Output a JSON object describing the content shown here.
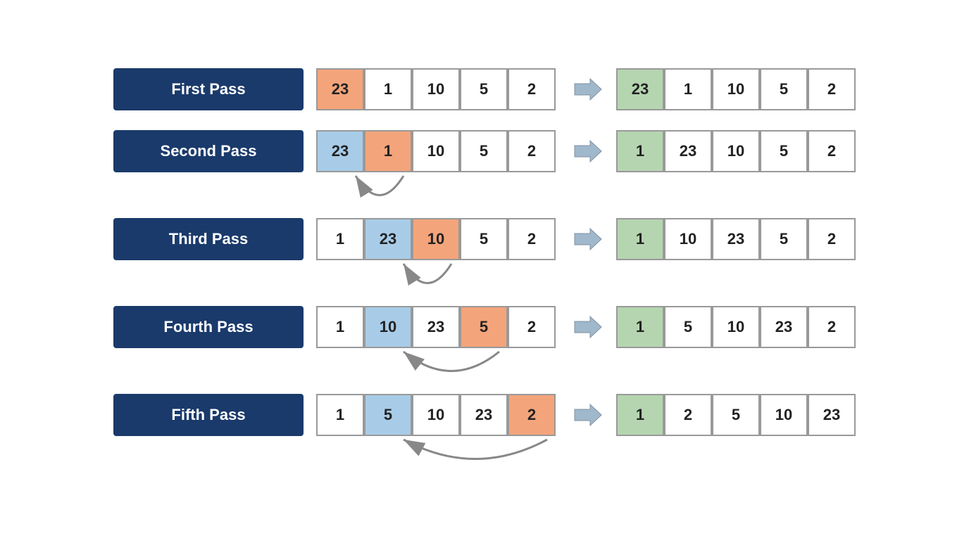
{
  "passes": [
    {
      "label": "First Pass",
      "before": [
        {
          "value": "23",
          "style": "orange"
        },
        {
          "value": "1",
          "style": ""
        },
        {
          "value": "10",
          "style": ""
        },
        {
          "value": "5",
          "style": ""
        },
        {
          "value": "2",
          "style": ""
        }
      ],
      "after": [
        {
          "value": "23",
          "style": "green"
        },
        {
          "value": "1",
          "style": ""
        },
        {
          "value": "10",
          "style": ""
        },
        {
          "value": "5",
          "style": ""
        },
        {
          "value": "2",
          "style": ""
        }
      ],
      "hasCurvedArrow": false,
      "curvedArrowFrom": 0,
      "curvedArrowTo": 0
    },
    {
      "label": "Second Pass",
      "before": [
        {
          "value": "23",
          "style": "blue"
        },
        {
          "value": "1",
          "style": "orange"
        },
        {
          "value": "10",
          "style": ""
        },
        {
          "value": "5",
          "style": ""
        },
        {
          "value": "2",
          "style": ""
        }
      ],
      "after": [
        {
          "value": "1",
          "style": "green"
        },
        {
          "value": "23",
          "style": ""
        },
        {
          "value": "10",
          "style": ""
        },
        {
          "value": "5",
          "style": ""
        },
        {
          "value": "2",
          "style": ""
        }
      ],
      "hasCurvedArrow": true,
      "curvedArrowFrom": 1,
      "curvedArrowTo": 0
    },
    {
      "label": "Third Pass",
      "before": [
        {
          "value": "1",
          "style": ""
        },
        {
          "value": "23",
          "style": "blue"
        },
        {
          "value": "10",
          "style": "orange"
        },
        {
          "value": "5",
          "style": ""
        },
        {
          "value": "2",
          "style": ""
        }
      ],
      "after": [
        {
          "value": "1",
          "style": "green"
        },
        {
          "value": "10",
          "style": ""
        },
        {
          "value": "23",
          "style": ""
        },
        {
          "value": "5",
          "style": ""
        },
        {
          "value": "2",
          "style": ""
        }
      ],
      "hasCurvedArrow": true,
      "curvedArrowFrom": 2,
      "curvedArrowTo": 1
    },
    {
      "label": "Fourth Pass",
      "before": [
        {
          "value": "1",
          "style": ""
        },
        {
          "value": "10",
          "style": "blue"
        },
        {
          "value": "23",
          "style": ""
        },
        {
          "value": "5",
          "style": "orange"
        },
        {
          "value": "2",
          "style": ""
        }
      ],
      "after": [
        {
          "value": "1",
          "style": "green"
        },
        {
          "value": "5",
          "style": ""
        },
        {
          "value": "10",
          "style": ""
        },
        {
          "value": "23",
          "style": ""
        },
        {
          "value": "2",
          "style": ""
        }
      ],
      "hasCurvedArrow": true,
      "curvedArrowFrom": 3,
      "curvedArrowTo": 1
    },
    {
      "label": "Fifth Pass",
      "before": [
        {
          "value": "1",
          "style": ""
        },
        {
          "value": "5",
          "style": "blue"
        },
        {
          "value": "10",
          "style": ""
        },
        {
          "value": "23",
          "style": ""
        },
        {
          "value": "2",
          "style": "orange"
        }
      ],
      "after": [
        {
          "value": "1",
          "style": "green"
        },
        {
          "value": "2",
          "style": ""
        },
        {
          "value": "5",
          "style": ""
        },
        {
          "value": "10",
          "style": ""
        },
        {
          "value": "23",
          "style": ""
        }
      ],
      "hasCurvedArrow": true,
      "curvedArrowFrom": 4,
      "curvedArrowTo": 1
    }
  ],
  "arrow": "⇒"
}
